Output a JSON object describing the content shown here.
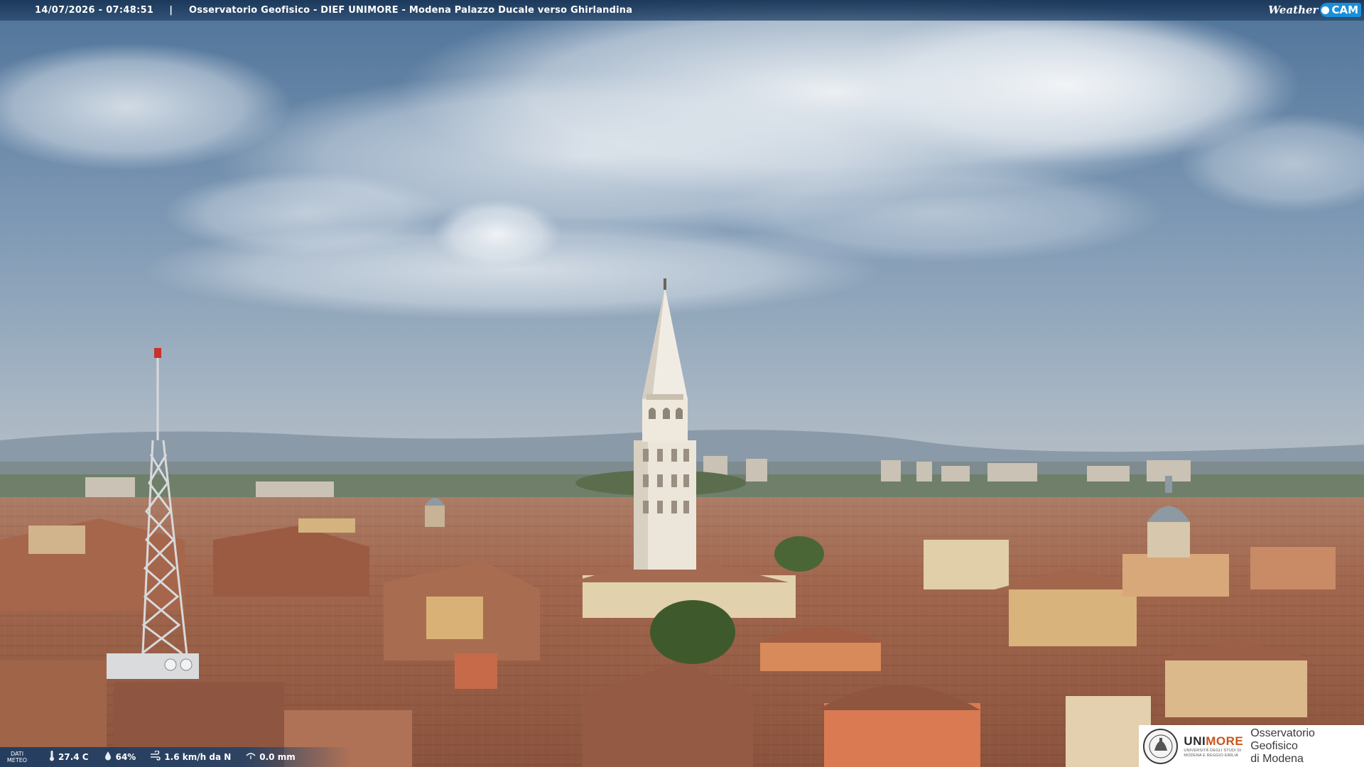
{
  "topbar": {
    "datetime": "14/07/2026 - 07:48:51",
    "separator": "|",
    "caption": "Osservatorio Geofisico - DIEF UNIMORE - Modena Palazzo Ducale verso Ghirlandina",
    "logo_left": "Weather",
    "logo_right": "CAM"
  },
  "meteo": {
    "label_line1": "DATI",
    "label_line2": "METEO",
    "temperature": "27.4 C",
    "temperature_icon": "thermometer-icon",
    "humidity": "64%",
    "humidity_icon": "droplet-icon",
    "wind": "1.6 km/h da N",
    "wind_icon": "wind-icon",
    "rain": "0.0 mm",
    "rain_icon": "rain-gauge-icon"
  },
  "institution": {
    "brand_first": "UNI",
    "brand_second": "MORE",
    "brand_sub_1": "UNIVERSITÀ DEGLI STUDI DI",
    "brand_sub_2": "MODENA E REGGIO EMILIA",
    "observatory_line1": "Osservatorio Geofisico",
    "observatory_line2": "di Modena",
    "seal_icon": "university-seal-icon"
  },
  "colors": {
    "bar_bg": "#1e4068",
    "sky_top": "#5b7ea3",
    "sky_bottom": "#a7b5c2",
    "roof": "#a0654a",
    "tower": "#e8e2d6",
    "unimore_orange": "#c8551b",
    "weathercam_blue": "#1a8fd8"
  }
}
